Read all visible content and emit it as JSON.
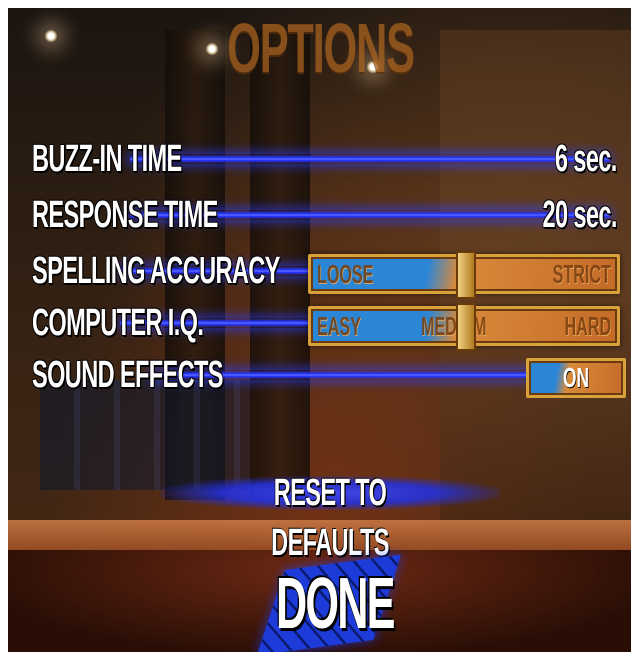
{
  "screen": {
    "title": "OPTIONS"
  },
  "options": [
    {
      "label": "BUZZ-IN TIME",
      "value": "6 sec."
    },
    {
      "label": "RESPONSE TIME",
      "value": "20 sec."
    },
    {
      "label": "SPELLING ACCURACY",
      "stops": [
        "LOOSE",
        "STRICT"
      ],
      "level": 0.5
    },
    {
      "label": "COMPUTER I.Q.",
      "stops": [
        "EASY",
        "MEDIUM",
        "HARD"
      ],
      "level": 0.5
    },
    {
      "label": "SOUND EFFECTS",
      "value": "ON"
    }
  ],
  "buttons": {
    "reset": "RESET TO DEFAULTS",
    "done": "DONE"
  },
  "colors": {
    "label_text": "#ffffff",
    "beam": "#2230ff",
    "title_text": "#a8621f",
    "slider_blue": "#2c86d6",
    "slider_orange": "#d98a3a",
    "slider_border": "#d9a13a"
  }
}
